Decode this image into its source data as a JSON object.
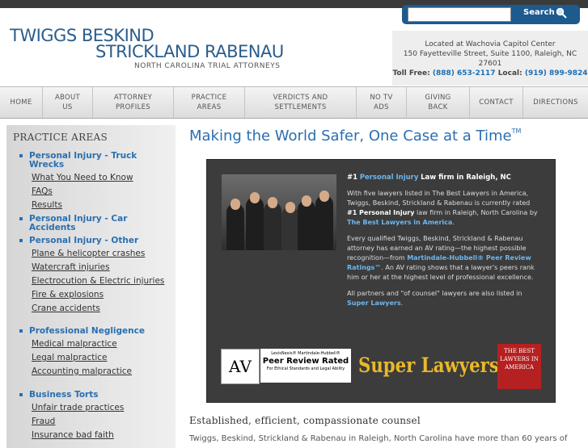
{
  "search": {
    "placeholder": "",
    "button_label": "Search"
  },
  "logo": {
    "line1": "TWIGGS BESKIND",
    "line2": "STRICKLAND RABENAU",
    "line3": "NORTH CAROLINA TRIAL ATTORNEYS"
  },
  "contact": {
    "location": "Located at Wachovia Capitol Center",
    "address": "150 Fayetteville Street, Suite 1100, Raleigh, NC 27601",
    "toll_free_label": "Toll Free:",
    "toll_free": "(888) 653-2117",
    "local_label": "Local:",
    "local": "(919) 899-9824"
  },
  "nav": [
    {
      "label": "HOME"
    },
    {
      "label": "ABOUT US"
    },
    {
      "label": "ATTORNEY PROFILES"
    },
    {
      "label": "PRACTICE AREAS"
    },
    {
      "label": "VERDICTS AND SETTLEMENTS"
    },
    {
      "label": "NO TV ADS"
    },
    {
      "label": "GIVING BACK"
    },
    {
      "label": "CONTACT"
    },
    {
      "label": "DIRECTIONS"
    }
  ],
  "sidebar": {
    "title": "PRACTICE AREAS",
    "items": [
      {
        "type": "main",
        "label": "Personal Injury - Truck"
      },
      {
        "type": "main",
        "label": "Wrecks"
      },
      {
        "type": "sub",
        "label": "What You Need to Know"
      },
      {
        "type": "sub",
        "label": "FAQs"
      },
      {
        "type": "sub",
        "label": "Results"
      },
      {
        "type": "main",
        "label": "Personal Injury - Car"
      },
      {
        "type": "main",
        "label": "Accidents"
      },
      {
        "type": "main",
        "label": "Personal Injury - Other"
      },
      {
        "type": "sub",
        "label": "Plane & helicopter crashes"
      },
      {
        "type": "sub",
        "label": "Watercraft injuries"
      },
      {
        "type": "sub",
        "label": "Electrocution & Electric injuries"
      },
      {
        "type": "sub",
        "label": "Fire & explosions"
      },
      {
        "type": "sub",
        "label": "Crane accidents"
      },
      {
        "type": "main",
        "label": "Professional Negligence"
      },
      {
        "type": "sub",
        "label": "Medical malpractice"
      },
      {
        "type": "sub",
        "label": "Legal malpractice"
      },
      {
        "type": "sub",
        "label": "Accounting malpractice"
      },
      {
        "type": "main",
        "label": "Business Torts"
      },
      {
        "type": "sub",
        "label": "Unfair trade practices"
      },
      {
        "type": "sub",
        "label": "Fraud"
      },
      {
        "type": "sub",
        "label": "Insurance bad faith"
      }
    ]
  },
  "main": {
    "title": "Making the World Safer, One Case at a Time",
    "title_tm": "TM",
    "feature": {
      "p1_prefix": "#1",
      "p1_link": "Personal Injury",
      "p1_suffix": "Law firm in Raleigh, NC",
      "p2_a": "With five lawyers listed in The Best Lawyers in America, Twiggs, Beskind, Strickland & Rabenau is currently rated",
      "p2_b": "#1 Personal Injury",
      "p2_c": "law firm in Raleigh, North Carolina by",
      "p2_link": "The Best Lawyers in America",
      "p2_end": ".",
      "p3_a": "Every qualified Twiggs, Beskind, Strickland & Rabenau attorney has earned an AV rating—the highest possible recognition—from",
      "p3_link": "Martindale-Hubbell® Peer Review Ratings™",
      "p3_b": ". An AV rating shows that a lawyer's peers rank him or her at the highest level of professional excellence.",
      "p4_a": "All partners and \"of counsel\" lawyers are also listed in",
      "p4_link": "Super Lawyers",
      "p4_end": "."
    },
    "badges": {
      "av": "AV",
      "mh_top": "LexisNexis® Martindale-Hubbell®",
      "mh_main": "Peer Review Rated",
      "mh_sub": "For Ethical Standards and Legal Ability",
      "super_lawyers": "Super Lawyers",
      "best_lawyers": "THE BEST LAWYERS IN AMERICA"
    },
    "subheading": "Established, efficient, compassionate counsel",
    "body_cut": "Twiggs, Beskind, Strickland & Rabenau in Raleigh, North Carolina have more than 60 years of"
  },
  "colors": {
    "brand_blue": "#2a6fb0",
    "search_bg": "#1d5a8e",
    "super_lawyers_gold": "#e8b92a",
    "best_lawyers_red": "#b52020"
  }
}
